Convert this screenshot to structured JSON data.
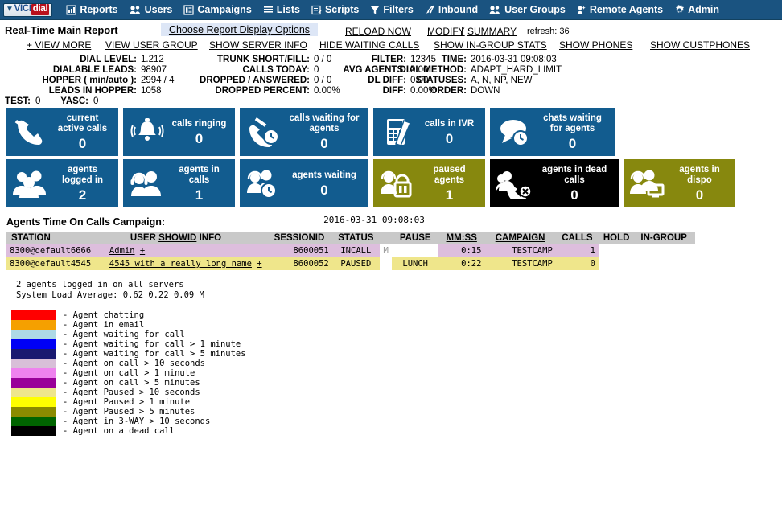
{
  "nav": {
    "logo": {
      "mark": "▼",
      "part1": "VICI",
      "part2": "dial"
    },
    "items": [
      {
        "label": "Reports",
        "icon": "report-chart-icon"
      },
      {
        "label": "Users",
        "icon": "users-icon"
      },
      {
        "label": "Campaigns",
        "icon": "campaign-list-icon"
      },
      {
        "label": "Lists",
        "icon": "lists-icon"
      },
      {
        "label": "Scripts",
        "icon": "script-pencil-icon"
      },
      {
        "label": "Filters",
        "icon": "funnel-filter-icon"
      },
      {
        "label": "Inbound",
        "icon": "inbound-arrow-icon"
      },
      {
        "label": "User Groups",
        "icon": "user-groups-icon"
      },
      {
        "label": "Remote Agents",
        "icon": "remote-agent-icon"
      },
      {
        "label": "Admin",
        "icon": "gear-icon"
      }
    ]
  },
  "header": {
    "title": "Real-Time Main Report",
    "choose_options": "Choose Report Display Options",
    "reload_now": "RELOAD NOW",
    "modify": "MODIFY",
    "separator": "|",
    "summary": "SUMMARY",
    "refresh": "refresh: 36",
    "links": [
      "+ VIEW MORE",
      "VIEW USER GROUP",
      "SHOW SERVER INFO",
      "HIDE WAITING CALLS",
      "SHOW IN-GROUP STATS",
      "SHOW PHONES",
      "SHOW CUSTPHONES"
    ]
  },
  "stats": {
    "col1": [
      {
        "label": "DIAL LEVEL:",
        "value": "1.212"
      },
      {
        "label": "DIALABLE LEADS:",
        "value": "98907"
      },
      {
        "label": "HOPPER ( min/auto ):",
        "value": "2994 / 4"
      },
      {
        "label": "LEADS IN HOPPER:",
        "value": "1058"
      }
    ],
    "col2": [
      {
        "label": "TRUNK SHORT/FILL:",
        "value": "0 / 0"
      },
      {
        "label": "CALLS TODAY:",
        "value": "0"
      },
      {
        "label": "DROPPED / ANSWERED:",
        "value": "0 / 0"
      },
      {
        "label": "DROPPED PERCENT:",
        "value": "0.00%"
      }
    ],
    "col3": [
      {
        "label": "FILTER:",
        "value": "12345"
      },
      {
        "label": "AVG AGENTS:",
        "value": "0.00"
      },
      {
        "label": "DL DIFF:",
        "value": "0.00"
      },
      {
        "label": "DIFF:",
        "value": "0.00%"
      }
    ],
    "col4": [
      {
        "label": "TIME:",
        "value": "2016-03-31 09:08:03"
      },
      {
        "label": "DIAL METHOD:",
        "value": "ADAPT_HARD_LIMIT"
      },
      {
        "label": "STATUSES:",
        "value": "A, N, NP, NEW"
      },
      {
        "label": "ORDER:",
        "value": "DOWN"
      }
    ],
    "bottom": [
      {
        "label": "TEST:",
        "value": "0"
      },
      {
        "label": "YASC:",
        "value": "0"
      }
    ]
  },
  "cards_row1": [
    {
      "label": "current active calls",
      "value": "0",
      "color": "blue",
      "icon": "phone-handset-icon"
    },
    {
      "label": "calls ringing",
      "value": "0",
      "color": "blue",
      "icon": "bell-ringing-icon"
    },
    {
      "label": "calls waiting for agents",
      "value": "0",
      "color": "blue",
      "icon": "phone-clock-icon"
    },
    {
      "label": "calls in IVR",
      "value": "0",
      "color": "blue",
      "icon": "ivr-keypad-icon"
    },
    {
      "label": "chats waiting for agents",
      "value": "0",
      "color": "blue",
      "icon": "chat-clock-icon"
    }
  ],
  "cards_row2": [
    {
      "label": "agents logged in",
      "value": "2",
      "color": "blue",
      "icon": "people-icon"
    },
    {
      "label": "agents in calls",
      "value": "1",
      "color": "blue",
      "icon": "headset-agents-icon"
    },
    {
      "label": "agents waiting",
      "value": "0",
      "color": "blue",
      "icon": "agent-clock-icon"
    },
    {
      "label": "paused agents",
      "value": "1",
      "color": "olive",
      "icon": "agent-pause-icon"
    },
    {
      "label": "agents in dead calls",
      "value": "0",
      "color": "black",
      "icon": "agent-dead-call-icon"
    },
    {
      "label": "agents in dispo",
      "value": "0",
      "color": "olive",
      "icon": "agent-screen-icon"
    }
  ],
  "agents": {
    "section_title": "Agents Time On Calls Campaign:",
    "datetime": "2016-03-31 09:08:03",
    "columns": [
      {
        "label": "STATION",
        "underline": false
      },
      {
        "label": "USER",
        "underline": true,
        "extra_show": "SHOW",
        "extra_id": "ID",
        "extra_info": "INFO"
      },
      {
        "label": "SESSIONID",
        "underline": false
      },
      {
        "label": "STATUS",
        "underline": false
      },
      {
        "label": "",
        "underline": false
      },
      {
        "label": "PAUSE",
        "underline": false
      },
      {
        "label": "MM:SS",
        "underline": true
      },
      {
        "label": "CAMPAIGN",
        "underline": true
      },
      {
        "label": "CALLS",
        "underline": false
      },
      {
        "label": "HOLD",
        "underline": false
      },
      {
        "label": "IN-GROUP",
        "underline": false
      }
    ],
    "rows": [
      {
        "station": "8300@default6666",
        "user": "Admin",
        "user_plus": "+",
        "sessionid": "8600051",
        "status": "INCALL",
        "flag": "M",
        "pause": "",
        "mmss": "0:15",
        "campaign": "TESTCAMP",
        "calls": "1",
        "hold": "",
        "ingroup": ""
      },
      {
        "station": "8300@default4545",
        "user": "4545 with a really long name",
        "user_plus": "+",
        "sessionid": "8600052",
        "status": "PAUSED",
        "flag": "",
        "pause": "LUNCH",
        "mmss": "0:22",
        "campaign": "TESTCAMP",
        "calls": "0",
        "hold": "",
        "ingroup": ""
      }
    ]
  },
  "footer": {
    "line1": "2 agents logged in on all servers",
    "line2": "System Load Average: 0.62 0.22 0.09     M"
  },
  "legend": [
    {
      "color": "#ff0000",
      "text": "- Agent chatting"
    },
    {
      "color": "#f5a000",
      "text": "- Agent in email"
    },
    {
      "color": "#aed9e6",
      "text": "- Agent waiting for call"
    },
    {
      "color": "#0000f5",
      "text": "- Agent waiting for call > 1 minute"
    },
    {
      "color": "#191970",
      "text": "- Agent waiting for call > 5 minutes"
    },
    {
      "color": "#d8bfd8",
      "text": "- Agent on call > 10 seconds"
    },
    {
      "color": "#ee82ee",
      "text": "- Agent on call > 1 minute"
    },
    {
      "color": "#990099",
      "text": "- Agent on call > 5 minutes"
    },
    {
      "color": "#eee68c",
      "text": "- Agent Paused > 10 seconds"
    },
    {
      "color": "#ffff00",
      "text": "- Agent Paused > 1 minute"
    },
    {
      "color": "#8b8b00",
      "text": "- Agent Paused > 5 minutes"
    },
    {
      "color": "#006400",
      "text": "- Agent in 3-WAY > 10 seconds"
    },
    {
      "color": "#000000",
      "text": "- Agent on a dead call"
    }
  ]
}
